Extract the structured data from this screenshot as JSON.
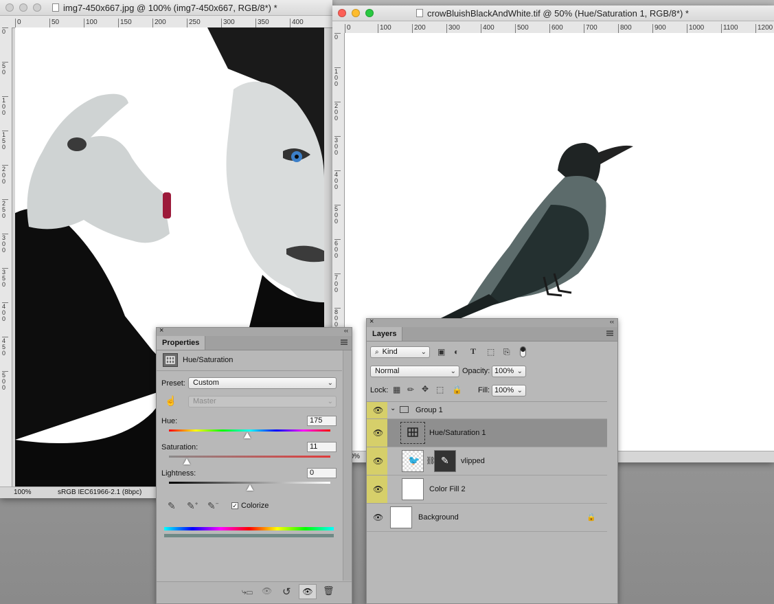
{
  "win1": {
    "title": "img7-450x667.jpg @ 100% (img7-450x667, RGB/8*) *",
    "ruler_h": [
      "0",
      "50",
      "100",
      "150",
      "200",
      "250",
      "300",
      "350",
      "400"
    ],
    "ruler_v": [
      "0",
      "50",
      "100",
      "150",
      "200",
      "250",
      "300",
      "350",
      "400",
      "450",
      "500"
    ],
    "zoom": "100%",
    "profile": "sRGB IEC61966-2.1 (8bpc)"
  },
  "win2": {
    "title": "crowBluishBlackAndWhite.tif @ 50% (Hue/Saturation 1, RGB/8*) *",
    "ruler_h": [
      "0",
      "100",
      "200",
      "300",
      "400",
      "500",
      "600",
      "700",
      "800",
      "900",
      "1000",
      "1100",
      "1200"
    ],
    "ruler_v": [
      "0",
      "100",
      "200",
      "300",
      "400",
      "500",
      "600",
      "700",
      "800"
    ],
    "zoom": "50%"
  },
  "properties": {
    "tab": "Properties",
    "adjustment": "Hue/Saturation",
    "preset_label": "Preset:",
    "preset_value": "Custom",
    "channel_value": "Master",
    "hue_label": "Hue:",
    "hue_value": "175",
    "hue_fraction": 0.486,
    "saturation_label": "Saturation:",
    "saturation_value": "11",
    "saturation_fraction": 0.11,
    "lightness_label": "Lightness:",
    "lightness_value": "0",
    "lightness_fraction": 0.5,
    "colorize_label": "Colorize",
    "colorize_checked": true,
    "colors": {
      "slider_red": "#e03a3a",
      "result_bar": "#6f8a86"
    }
  },
  "layers": {
    "tab": "Layers",
    "filter_kind": "Kind",
    "blend_mode": "Normal",
    "opacity_label": "Opacity:",
    "opacity_value": "100%",
    "lock_label": "Lock:",
    "fill_label": "Fill:",
    "fill_value": "100%",
    "items": [
      {
        "name": "Group 1"
      },
      {
        "name": "Hue/Saturation 1"
      },
      {
        "name": "vlipped"
      },
      {
        "name": "Color Fill 2"
      },
      {
        "name": "Background"
      }
    ],
    "colors": {
      "visibility_highlight": "#d6cf6a",
      "selected_row": "#8f8f8f"
    }
  }
}
